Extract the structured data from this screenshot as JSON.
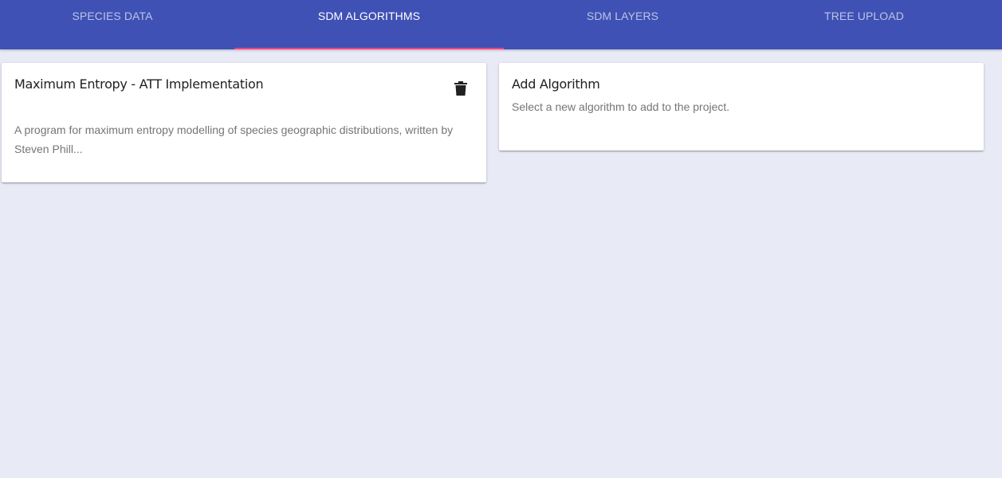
{
  "tabs": [
    {
      "label": "SPECIES DATA",
      "active": false
    },
    {
      "label": "SDM ALGORITHMS",
      "active": true
    },
    {
      "label": "SDM LAYERS",
      "active": false
    },
    {
      "label": "TREE UPLOAD",
      "active": false
    }
  ],
  "algorithm_card": {
    "title": "Maximum Entropy - ATT Implementation",
    "description": "A program for maximum entropy modelling of species geographic distributions, written by Steven Phill...",
    "delete_icon": "trash-icon"
  },
  "add_card": {
    "title": "Add Algorithm",
    "subtitle": "Select a new algorithm to add to the project."
  },
  "colors": {
    "tabbar": "#3f51b5",
    "ink_bar": "#ff4081",
    "background": "#e8eaf6"
  }
}
